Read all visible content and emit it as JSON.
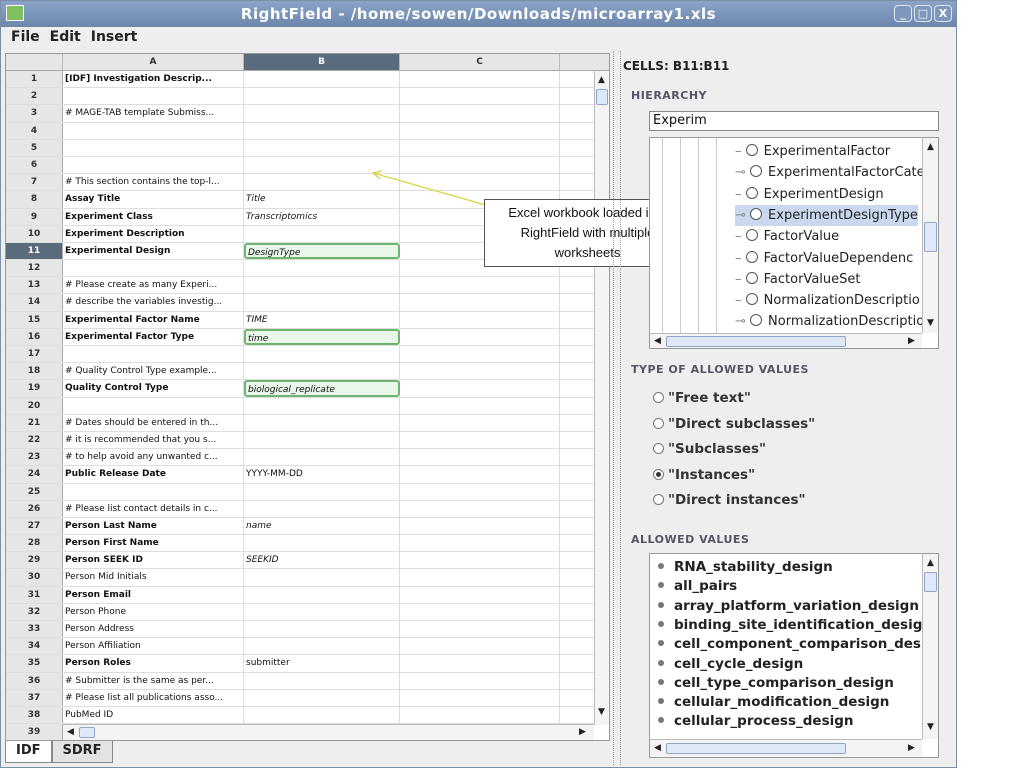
{
  "window": {
    "title": "RightField - /home/sowen/Downloads/microarray1.xls",
    "app_icon": "spreadsheet-icon",
    "controls": [
      "_",
      "□",
      "X"
    ]
  },
  "menu": [
    "File",
    "Edit",
    "Insert"
  ],
  "sheet": {
    "columns": [
      "A",
      "B",
      "C"
    ],
    "selected_column": "B",
    "selected_row": 11,
    "rows": [
      {
        "n": "1",
        "a": "[IDF] Investigation Descrip...",
        "b": "",
        "bold": true
      },
      {
        "n": "2",
        "a": "",
        "b": ""
      },
      {
        "n": "3",
        "a": "# MAGE-TAB template Submiss...",
        "b": ""
      },
      {
        "n": "4",
        "a": "",
        "b": ""
      },
      {
        "n": "5",
        "a": "",
        "b": ""
      },
      {
        "n": "6",
        "a": "",
        "b": ""
      },
      {
        "n": "7",
        "a": "# This section contains the top-l...",
        "b": ""
      },
      {
        "n": "8",
        "a": "Assay Title",
        "b": "Title",
        "bold": true
      },
      {
        "n": "9",
        "a": "Experiment Class",
        "b": "Transcriptomics",
        "bold": true
      },
      {
        "n": "10",
        "a": "Experiment Description",
        "b": "",
        "bold": true
      },
      {
        "n": "11",
        "a": "Experimental Design",
        "b": "DesignType",
        "bold": true,
        "ont": true
      },
      {
        "n": "12",
        "a": "",
        "b": ""
      },
      {
        "n": "13",
        "a": "# Please create as many Experi...",
        "b": ""
      },
      {
        "n": "14",
        "a": "# describe the variables investig...",
        "b": ""
      },
      {
        "n": "15",
        "a": "Experimental Factor Name",
        "b": "TIME",
        "bold": true
      },
      {
        "n": "16",
        "a": "Experimental Factor Type",
        "b": "time",
        "bold": true,
        "ont": true
      },
      {
        "n": "17",
        "a": "",
        "b": ""
      },
      {
        "n": "18",
        "a": "# Quality Control Type example...",
        "b": ""
      },
      {
        "n": "19",
        "a": "Quality Control Type",
        "b": "biological_replicate",
        "bold": true,
        "ont": true
      },
      {
        "n": "20",
        "a": "",
        "b": ""
      },
      {
        "n": "21",
        "a": "# Dates should be entered in th...",
        "b": ""
      },
      {
        "n": "22",
        "a": "# it is recommended that you s...",
        "b": ""
      },
      {
        "n": "23",
        "a": "# to help avoid any unwanted c...",
        "b": ""
      },
      {
        "n": "24",
        "a": "Public Release Date",
        "b": "YYYY-MM-DD",
        "bold": true,
        "plainb": true
      },
      {
        "n": "25",
        "a": "",
        "b": ""
      },
      {
        "n": "26",
        "a": "# Please list contact details in c...",
        "b": ""
      },
      {
        "n": "27",
        "a": "Person Last Name",
        "b": "name",
        "bold": true
      },
      {
        "n": "28",
        "a": "Person First Name",
        "b": "",
        "bold": true
      },
      {
        "n": "29",
        "a": "Person SEEK ID",
        "b": "SEEKID",
        "bold": true
      },
      {
        "n": "30",
        "a": "Person Mid Initials",
        "b": ""
      },
      {
        "n": "31",
        "a": "Person Email",
        "b": "",
        "bold": true
      },
      {
        "n": "32",
        "a": "Person Phone",
        "b": ""
      },
      {
        "n": "33",
        "a": "Person Address",
        "b": ""
      },
      {
        "n": "34",
        "a": "Person Affiliation",
        "b": ""
      },
      {
        "n": "35",
        "a": "Person Roles",
        "b": "submitter",
        "bold": true,
        "plainb": true
      },
      {
        "n": "36",
        "a": "# Submitter is the same as per...",
        "b": ""
      },
      {
        "n": "37",
        "a": "# Please list all publications asso...",
        "b": ""
      },
      {
        "n": "38",
        "a": "PubMed ID",
        "b": ""
      },
      {
        "n": "39",
        "a": "",
        "b": ""
      }
    ],
    "tabs": [
      "IDF",
      "SDRF"
    ],
    "active_tab": "IDF"
  },
  "callout": {
    "line1": "Excel workbook loaded into",
    "line2": "RightField with multiple",
    "line3": "worksheets"
  },
  "panel": {
    "cells_label": "CELLS: B11:B11",
    "hierarchy_label": "HIERARCHY",
    "search_value": "Experim",
    "tree_nodes": [
      {
        "label": "ExperimentalFactor",
        "expand": false
      },
      {
        "label": "ExperimentalFactorCate",
        "expand": true
      },
      {
        "label": "ExperimentDesign",
        "expand": false
      },
      {
        "label": "ExperimentDesignType",
        "expand": true,
        "selected": true
      },
      {
        "label": "FactorValue",
        "expand": false
      },
      {
        "label": "FactorValueDependenc",
        "expand": false
      },
      {
        "label": "FactorValueSet",
        "expand": false
      },
      {
        "label": "NormalizationDescriptio",
        "expand": false
      },
      {
        "label": "NormalizationDescriptio",
        "expand": true
      }
    ],
    "type_label": "TYPE OF ALLOWED VALUES",
    "types": [
      {
        "label": "\"Free text\"",
        "checked": false
      },
      {
        "label": "\"Direct subclasses\"",
        "checked": false
      },
      {
        "label": "\"Subclasses\"",
        "checked": false
      },
      {
        "label": "\"Instances\"",
        "checked": true
      },
      {
        "label": "\"Direct instances\"",
        "checked": false
      }
    ],
    "allowed_label": "ALLOWED VALUES",
    "allowed_values": [
      "RNA_stability_design",
      "all_pairs",
      "array_platform_variation_design",
      "binding_site_identification_design",
      "cell_component_comparison_design",
      "cell_cycle_design",
      "cell_type_comparison_design",
      "cellular_modification_design",
      "cellular_process_design"
    ]
  },
  "colors": {
    "ontology_cell_fill": "#e9f6ea",
    "ontology_cell_border": "#6fb46f",
    "selected_header": "#5b6b7e",
    "tree_selection": "#c9d8ee"
  }
}
